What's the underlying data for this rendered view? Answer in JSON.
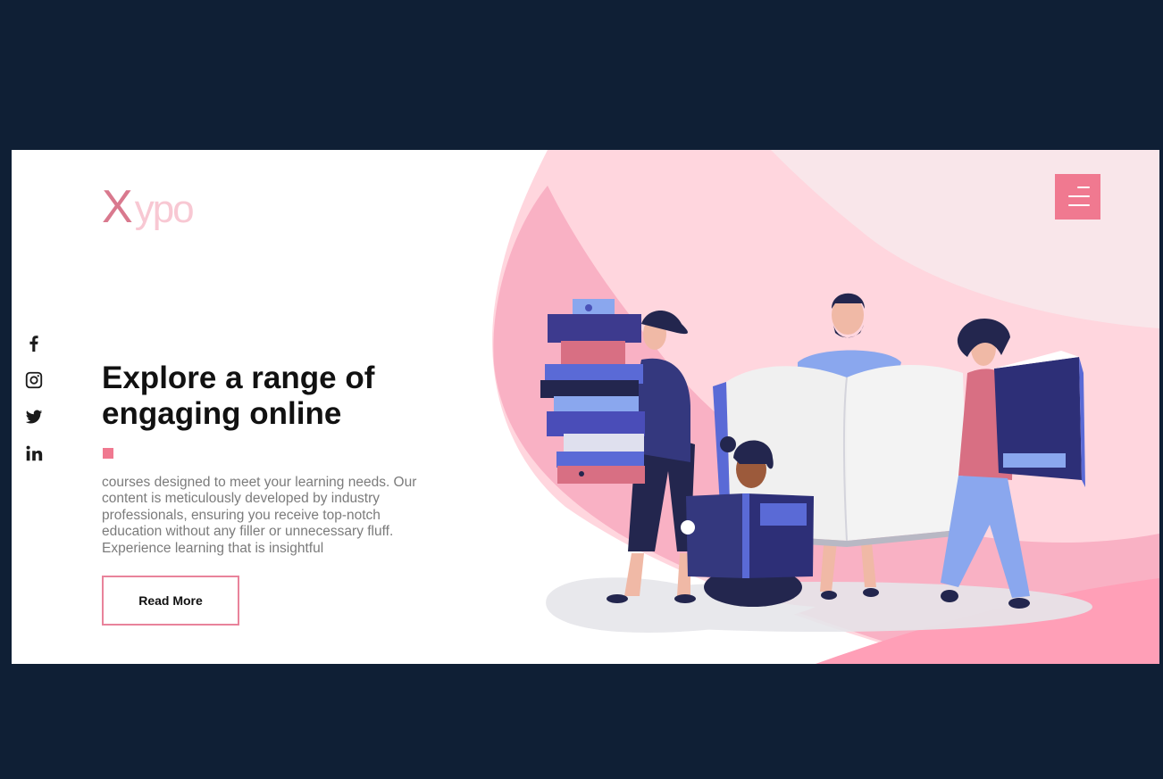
{
  "brand": {
    "logo_first": "X",
    "logo_rest": "ypo",
    "accent_color": "#f07990"
  },
  "header": {
    "menu_icon": "hamburger-menu-icon"
  },
  "social": [
    {
      "name": "facebook",
      "icon": "facebook-icon"
    },
    {
      "name": "instagram",
      "icon": "instagram-icon"
    },
    {
      "name": "twitter",
      "icon": "twitter-icon"
    },
    {
      "name": "linkedin",
      "icon": "linkedin-icon"
    }
  ],
  "hero": {
    "headline": "Explore a range of engaging online",
    "description": "courses designed to meet your learning needs. Our content is meticulously developed by industry professionals, ensuring you receive top-notch education without any filler or unnecessary fluff. Experience learning that is insightful",
    "cta_label": "Read More"
  },
  "colors": {
    "page_background": "#0f1f35",
    "card_background": "#ffffff",
    "heading": "#111111",
    "body_text": "#7b7b7b",
    "pink_light": "#ffd6de",
    "pink_mid": "#f9b1c4",
    "navy": "#2d2f77"
  }
}
